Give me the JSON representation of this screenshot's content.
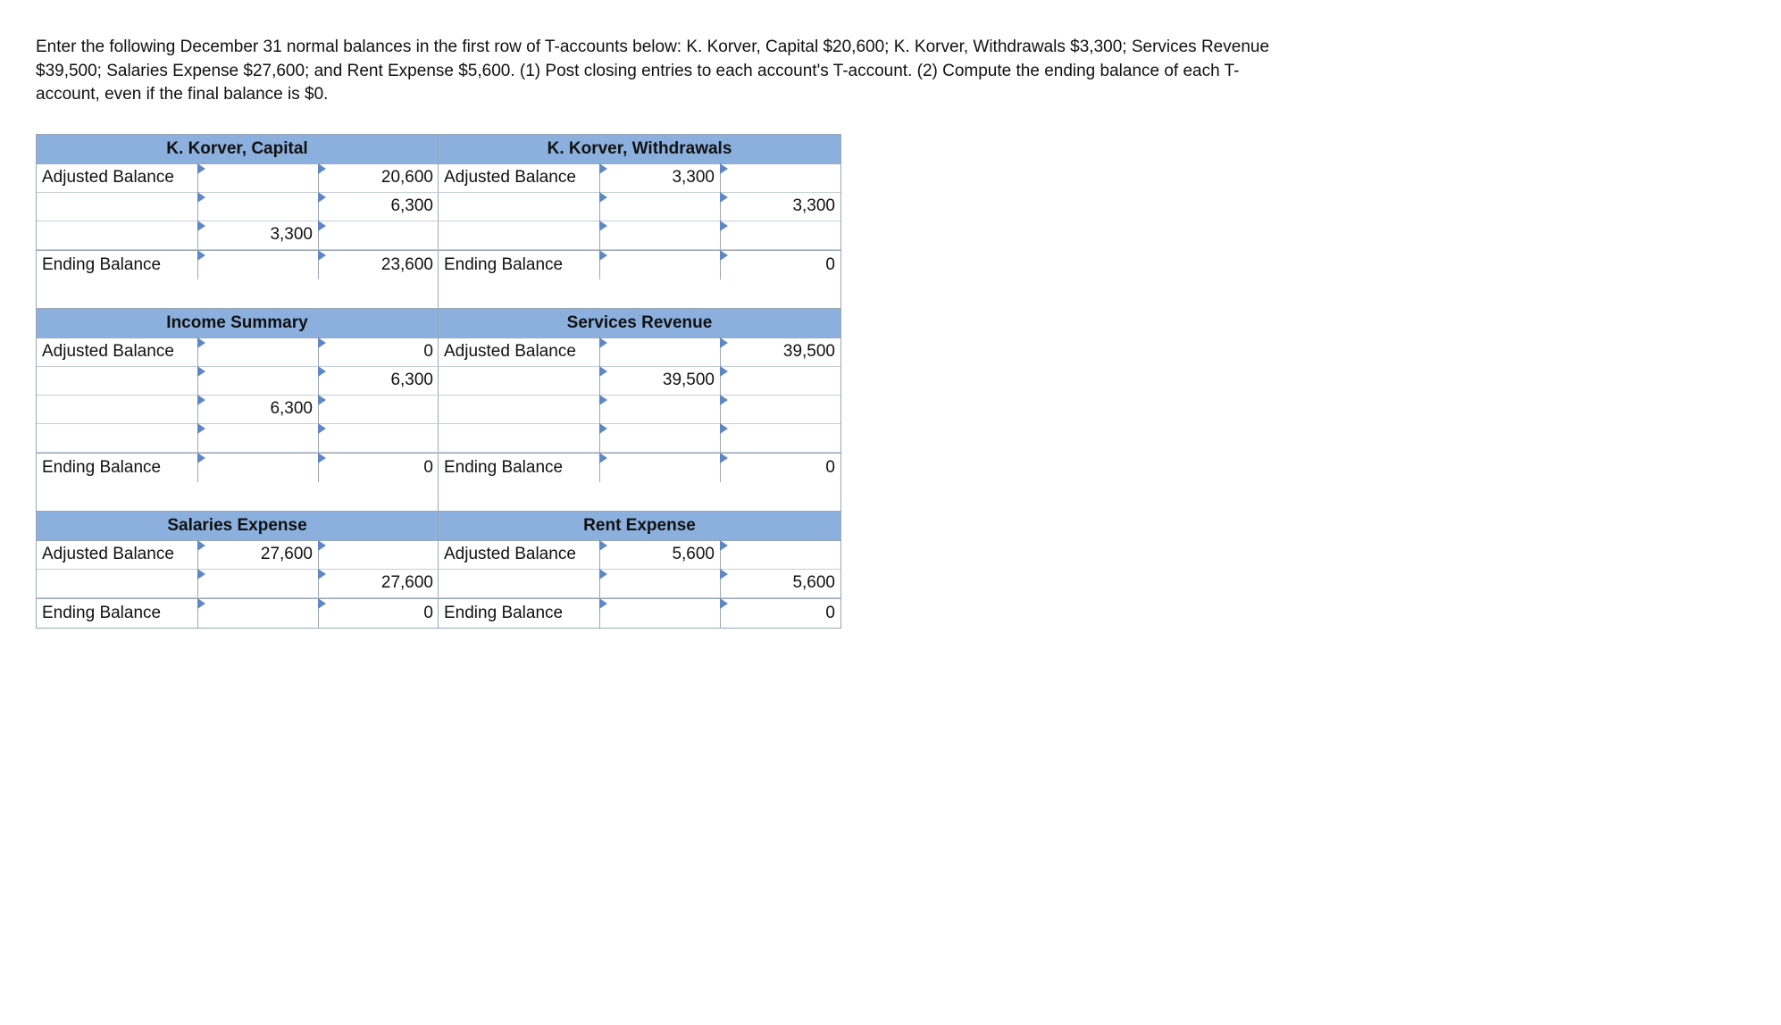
{
  "instructions": "Enter the following December 31 normal balances in the first row of T-accounts below: K. Korver, Capital $20,600; K. Korver, Withdrawals $3,300; Services Revenue $39,500; Salaries Expense $27,600; and Rent Expense $5,600. (1) Post closing entries to each account's T-account. (2) Compute the ending balance of each T-account, even if the final balance is $0.",
  "labels": {
    "adjusted": "Adjusted Balance",
    "ending": "Ending Balance"
  },
  "accounts": {
    "capital": {
      "title": "K. Korver, Capital",
      "r1_debit": "",
      "r1_credit": "20,600",
      "r2_debit": "",
      "r2_credit": "6,300",
      "r3_debit": "3,300",
      "r3_credit": "",
      "end_debit": "",
      "end_credit": "23,600"
    },
    "withdrawals": {
      "title": "K. Korver, Withdrawals",
      "r1_debit": "3,300",
      "r1_credit": "",
      "r2_debit": "",
      "r2_credit": "3,300",
      "r3_debit": "",
      "r3_credit": "",
      "end_debit": "",
      "end_credit": "0"
    },
    "income_summary": {
      "title": "Income Summary",
      "r1_debit": "",
      "r1_credit": "0",
      "r2_debit": "",
      "r2_credit": "6,300",
      "r3_debit": "6,300",
      "r3_credit": "",
      "r4_debit": "",
      "r4_credit": "",
      "end_debit": "",
      "end_credit": "0"
    },
    "services_revenue": {
      "title": "Services Revenue",
      "r1_debit": "",
      "r1_credit": "39,500",
      "r2_debit": "39,500",
      "r2_credit": "",
      "r3_debit": "",
      "r3_credit": "",
      "r4_debit": "",
      "r4_credit": "",
      "end_debit": "",
      "end_credit": "0"
    },
    "salaries_expense": {
      "title": "Salaries Expense",
      "r1_debit": "27,600",
      "r1_credit": "",
      "r2_debit": "",
      "r2_credit": "27,600",
      "end_debit": "",
      "end_credit": "0"
    },
    "rent_expense": {
      "title": "Rent Expense",
      "r1_debit": "5,600",
      "r1_credit": "",
      "r2_debit": "",
      "r2_credit": "5,600",
      "end_debit": "",
      "end_credit": "0"
    }
  }
}
